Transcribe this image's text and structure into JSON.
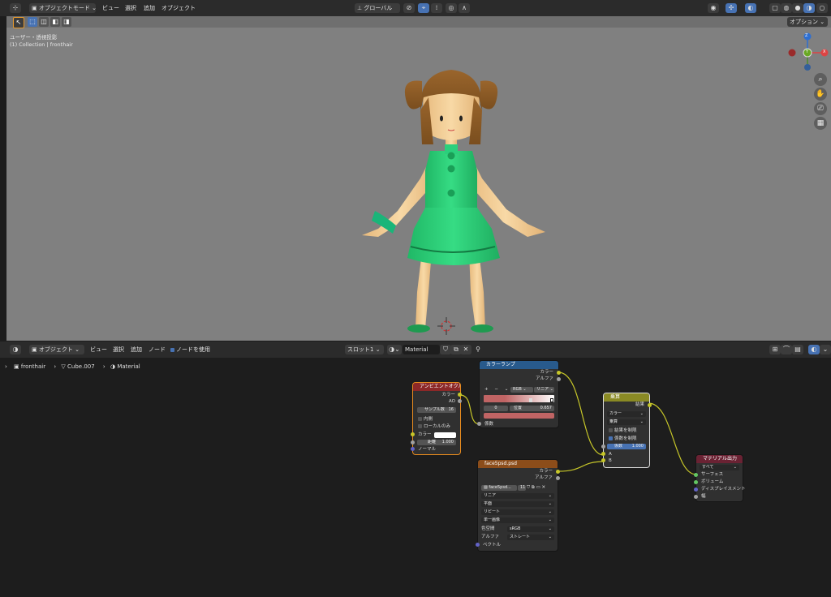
{
  "top_header": {
    "mode": "オブジェクトモード",
    "menus": [
      "ビュー",
      "選択",
      "追加",
      "オブジェクト"
    ],
    "transform": "グローバル",
    "options": "オプション"
  },
  "viewport": {
    "view_label": "ユーザー・透視投影",
    "collection_label": "(1) Collection | fronthair",
    "gizmo": {
      "z": "Z",
      "y": "Y",
      "x": "X"
    }
  },
  "node_header": {
    "mode": "オブジェクト",
    "menus": [
      "ビュー",
      "選択",
      "追加",
      "ノード"
    ],
    "use_nodes": "ノードを使用",
    "slot": "スロット1",
    "material": "Material"
  },
  "breadcrumb": {
    "object": "fronthair",
    "mesh": "Cube.007",
    "material": "Material"
  },
  "nodes": {
    "ao": {
      "title": "アンビエントオクル...",
      "out_color": "カラー",
      "out_ao": "AO",
      "samples_label": "サンプル数",
      "samples_value": "16",
      "inside": "内側",
      "only_local": "ローカルのみ",
      "in_color": "カラー",
      "distance_label": "距離",
      "distance_value": "1.000",
      "normal": "ノーマル"
    },
    "ramp": {
      "title": "カラーランプ",
      "out_color": "カラー",
      "out_alpha": "アルファ",
      "plus": "+",
      "minus": "−",
      "color_mode": "RGB",
      "interpolation": "リニア",
      "index": "0",
      "pos_label": "位置",
      "pos_value": "0.657",
      "in_fac": "係数"
    },
    "mix": {
      "title": "乗算",
      "out_result": "結果",
      "data_type": "カラー",
      "blend": "乗算",
      "clamp_result": "結果を制限",
      "clamp_factor": "係数を制限",
      "fac_label": "係数",
      "fac_value": "1.000",
      "in_a": "A",
      "in_b": "B"
    },
    "tex": {
      "title": "face5psd.psd",
      "out_color": "カラー",
      "out_alpha": "アルファ",
      "image_name": "face5psd...",
      "users": "11",
      "interpolation": "リニア",
      "projection": "平面",
      "extension": "リピート",
      "source": "単一画像",
      "colorspace_label": "色空間",
      "colorspace_value": "sRGB",
      "alpha_label": "アルファ",
      "alpha_value": "ストレート",
      "in_vector": "ベクトル"
    },
    "output": {
      "title": "マテリアル出力",
      "target": "すべて",
      "surface": "サーフェス",
      "volume": "ボリューム",
      "displacement": "ディスプレイスメント",
      "thickness": "幅"
    }
  },
  "colors": {
    "bg": "#1d1d1d",
    "viewport_bg": "#808080",
    "dress": "#2ed47a",
    "hair": "#8a5a26",
    "skin": "#f3cf98"
  }
}
